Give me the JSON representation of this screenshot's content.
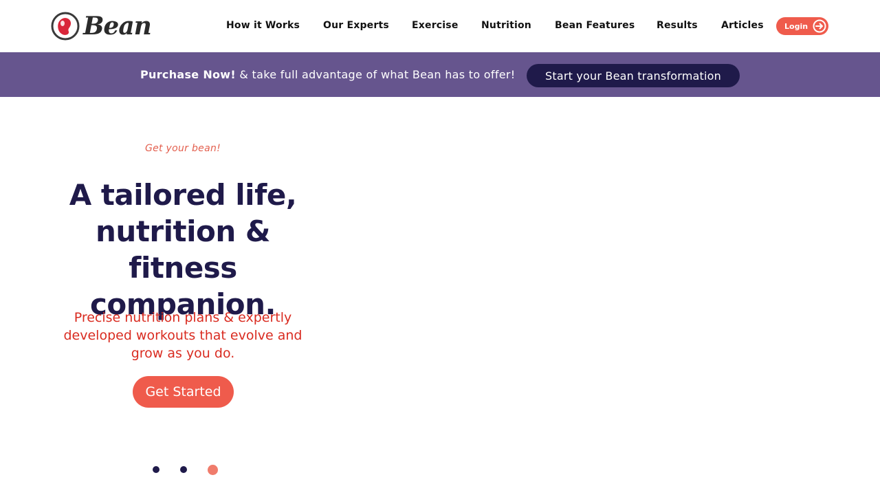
{
  "brand": {
    "name": "Bean",
    "colors": {
      "accent": "#ef5b4c",
      "navy": "#1f1a4a",
      "promo_bg": "#66558e",
      "subtext": "#d92b20"
    }
  },
  "nav": {
    "items": [
      {
        "label": "How it Works"
      },
      {
        "label": "Our Experts"
      },
      {
        "label": "Exercise"
      },
      {
        "label": "Nutrition"
      },
      {
        "label": "Bean Features"
      },
      {
        "label": "Results"
      },
      {
        "label": "Articles"
      }
    ],
    "login_label": "Login",
    "login_icon": "arrow-right-circle-icon"
  },
  "promo": {
    "bold": "Purchase Now!",
    "text": " & take full advantage of what Bean has to offer!",
    "button": "Start your Bean transformation"
  },
  "hero": {
    "eyebrow": "Get your bean!",
    "headline": "A tailored life, nutrition & fitness companion.",
    "subtext": "Precise nutrition plans & expertly developed workouts that evolve and grow as you do.",
    "cta": "Get Started"
  },
  "carousel": {
    "slide_count": 3,
    "active_index": 3
  }
}
